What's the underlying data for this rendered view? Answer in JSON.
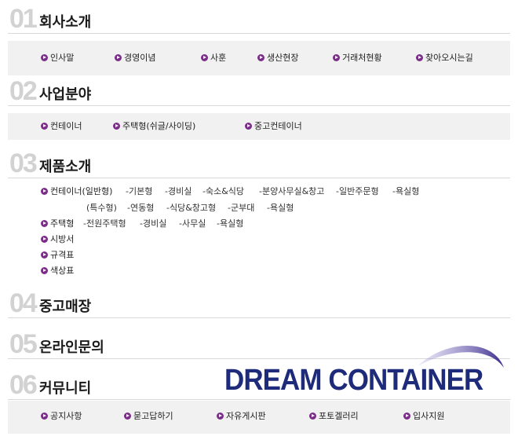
{
  "sections": [
    {
      "num": "01",
      "title": "회사소개",
      "items": [
        "인사말",
        "경영이념",
        "사훈",
        "생산현장",
        "거래처현황",
        "찾아오시는길"
      ]
    },
    {
      "num": "02",
      "title": "사업분야",
      "items": [
        "컨테이너",
        "주택형(쉬글/사이딩)",
        "중고컨테이너"
      ]
    },
    {
      "num": "03",
      "title": "제품소개",
      "container_label": "컨테이너(일반형)",
      "container_general_subs": [
        "-기본형",
        "-경비실",
        "-숙소&식당",
        "-분양사무실&창고",
        "-일반주문형",
        "-욕실형"
      ],
      "container_special_label": "(특수형)",
      "container_special_subs": [
        "-연동형",
        "-식당&창고형",
        "-군부대",
        "-욕실형"
      ],
      "house_label": "주택형",
      "house_subs": [
        "-전원주택형",
        "-경비실",
        "-사무실",
        "-욕실형"
      ],
      "other_items": [
        "시방서",
        "규격표",
        "색상표"
      ]
    },
    {
      "num": "04",
      "title": "중고매장"
    },
    {
      "num": "05",
      "title": "온라인문의"
    },
    {
      "num": "06",
      "title": "커뮤니티",
      "items": [
        "공지사항",
        "묻고답하기",
        "자유게시판",
        "포토겔러리",
        "입사지원"
      ]
    }
  ],
  "logo": {
    "text": "DREAM CONTAINER",
    "color": "#1e2a7a",
    "swoosh_color": "#3a2a8c"
  },
  "colors": {
    "bullet": "#7a2e87",
    "number": "#d2d2d2",
    "panel": "#f1f1f1"
  }
}
